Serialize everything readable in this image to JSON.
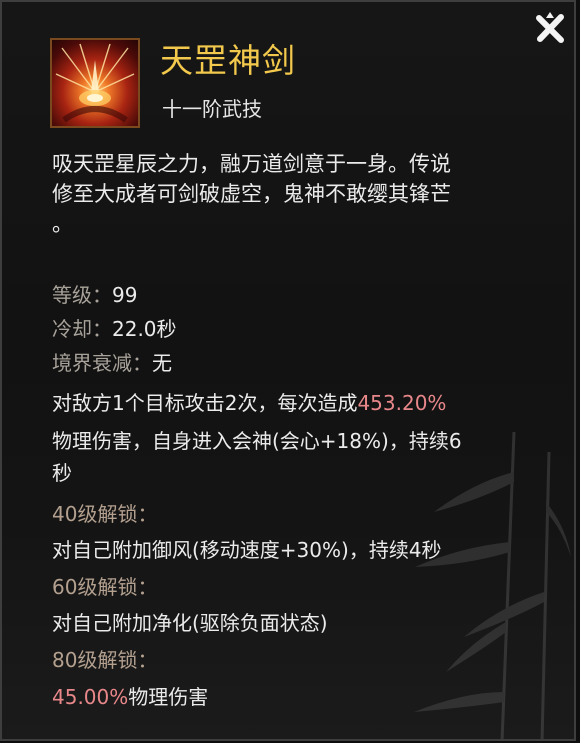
{
  "skill": {
    "name": "天罡神剑",
    "rank": "十一阶武技",
    "description_lines": [
      "吸天罡星辰之力，融万道剑意于一身。传说",
      "修至大成者可剑破虚空，鬼神不敢缨其锋芒",
      "。"
    ],
    "icon": "flaming-sword-burst-icon"
  },
  "stats": {
    "level_label": "等级：",
    "level_value": "99",
    "cooldown_label": "冷却：",
    "cooldown_value": "22.0秒",
    "decay_label": "境界衰减：",
    "decay_value": "无"
  },
  "effect": {
    "line1_prefix": "对敌方1个目标攻击2次，每次造成",
    "line1_value": "453.20%",
    "line2": "物理伤害，自身进入会神(会心+18%)，持续6",
    "line3": "秒"
  },
  "unlocks": [
    {
      "label": "40级解锁：",
      "text": "对自己附加御风(移动速度+30%)，持续4秒"
    },
    {
      "label": "60级解锁：",
      "text": "对自己附加净化(驱除负面状态)"
    },
    {
      "label": "80级解锁：",
      "value": "45.00%",
      "text": "物理伤害"
    }
  ],
  "colors": {
    "title": "#f2c94c",
    "label": "#a8a29a",
    "unlock_label": "#b3a08f",
    "highlight": "#e8878a",
    "text": "#ebebeb"
  },
  "close_icon": "close-x-icon"
}
